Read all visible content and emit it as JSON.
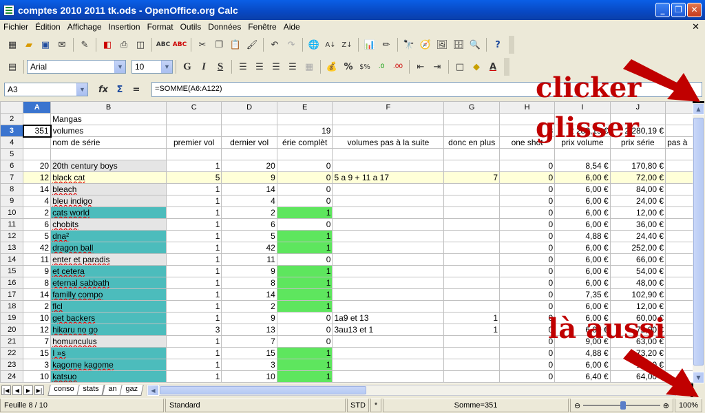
{
  "window": {
    "title": "comptes 2010 2011 tk.ods - OpenOffice.org Calc"
  },
  "menu": {
    "items": [
      "Fichier",
      "Édition",
      "Affichage",
      "Insertion",
      "Format",
      "Outils",
      "Données",
      "Fenêtre",
      "Aide"
    ]
  },
  "font": {
    "name": "Arial",
    "size": "10"
  },
  "namebox": {
    "value": "A3"
  },
  "formula": {
    "value": "=SOMME(A6:A122)"
  },
  "columns": [
    "A",
    "B",
    "C",
    "D",
    "E",
    "F",
    "G",
    "H",
    "I",
    "J"
  ],
  "rows": [
    {
      "n": "2",
      "a": "",
      "b": "Mangas",
      "c": "",
      "d": "",
      "e": "",
      "f": "",
      "g": "",
      "h": "",
      "i": "",
      "j": ""
    },
    {
      "n": "3",
      "a": "351",
      "b": "volumes",
      "c": "",
      "d": "",
      "e": "19",
      "f": "",
      "g": "",
      "h": "3",
      "i": "2 280,19 €",
      "j": "2 280,19 €"
    },
    {
      "n": "4",
      "a": "",
      "b": "nom de série",
      "c": "premier vol",
      "d": "dernier vol",
      "e": "érie complèt",
      "f": "volumes pas à la suite",
      "g": "donc en plus",
      "h": "one shot",
      "i": "prix volume",
      "j": "prix série"
    },
    {
      "n": "5",
      "a": "",
      "b": "",
      "c": "",
      "d": "",
      "e": "",
      "f": "",
      "g": "",
      "h": "",
      "i": "",
      "j": ""
    },
    {
      "n": "6",
      "a": "20",
      "b": "20th century boys",
      "c": "1",
      "d": "20",
      "e": "0",
      "f": "",
      "g": "",
      "h": "0",
      "i": "8,54 €",
      "j": "170,80 €"
    },
    {
      "n": "7",
      "a": "12",
      "b": "black cat",
      "c": "5",
      "d": "9",
      "e": "0",
      "f": "5 a 9  + 11 a 17",
      "g": "7",
      "h": "0",
      "i": "6,00 €",
      "j": "72,00 €"
    },
    {
      "n": "8",
      "a": "14",
      "b": "bleach",
      "c": "1",
      "d": "14",
      "e": "0",
      "f": "",
      "g": "",
      "h": "0",
      "i": "6,00 €",
      "j": "84,00 €"
    },
    {
      "n": "9",
      "a": "4",
      "b": "bleu indigo",
      "c": "1",
      "d": "4",
      "e": "0",
      "f": "",
      "g": "",
      "h": "0",
      "i": "6,00 €",
      "j": "24,00 €"
    },
    {
      "n": "10",
      "a": "2",
      "b": "cats world",
      "c": "1",
      "d": "2",
      "e": "1",
      "f": "",
      "g": "",
      "h": "0",
      "i": "6,00 €",
      "j": "12,00 €"
    },
    {
      "n": "11",
      "a": "6",
      "b": "chobits",
      "c": "1",
      "d": "6",
      "e": "0",
      "f": "",
      "g": "",
      "h": "0",
      "i": "6,00 €",
      "j": "36,00 €"
    },
    {
      "n": "12",
      "a": "5",
      "b": "dna²",
      "c": "1",
      "d": "5",
      "e": "1",
      "f": "",
      "g": "",
      "h": "0",
      "i": "4,88 €",
      "j": "24,40 €"
    },
    {
      "n": "13",
      "a": "42",
      "b": "dragon ball",
      "c": "1",
      "d": "42",
      "e": "1",
      "f": "",
      "g": "",
      "h": "0",
      "i": "6,00 €",
      "j": "252,00 €"
    },
    {
      "n": "14",
      "a": "11",
      "b": "enter et paradis",
      "c": "1",
      "d": "11",
      "e": "0",
      "f": "",
      "g": "",
      "h": "0",
      "i": "6,00 €",
      "j": "66,00 €"
    },
    {
      "n": "15",
      "a": "9",
      "b": "et cetera",
      "c": "1",
      "d": "9",
      "e": "1",
      "f": "",
      "g": "",
      "h": "0",
      "i": "6,00 €",
      "j": "54,00 €"
    },
    {
      "n": "16",
      "a": "8",
      "b": "eternal sabbath",
      "c": "1",
      "d": "8",
      "e": "1",
      "f": "",
      "g": "",
      "h": "0",
      "i": "6,00 €",
      "j": "48,00 €"
    },
    {
      "n": "17",
      "a": "14",
      "b": "familly compo",
      "c": "1",
      "d": "14",
      "e": "1",
      "f": "",
      "g": "",
      "h": "0",
      "i": "7,35 €",
      "j": "102,90 €"
    },
    {
      "n": "18",
      "a": "2",
      "b": "flcl",
      "c": "1",
      "d": "2",
      "e": "1",
      "f": "",
      "g": "",
      "h": "0",
      "i": "6,00 €",
      "j": "12,00 €"
    },
    {
      "n": "19",
      "a": "10",
      "b": "get backers",
      "c": "1",
      "d": "9",
      "e": "0",
      "f": "1a9 et 13",
      "g": "1",
      "h": "0",
      "i": "6,00 €",
      "j": "60,00 €"
    },
    {
      "n": "20",
      "a": "12",
      "b": "hikaru no go",
      "c": "3",
      "d": "13",
      "e": "0",
      "f": "3au13 et 1",
      "g": "1",
      "h": "0",
      "i": "6,00 €",
      "j": "72,00 €"
    },
    {
      "n": "21",
      "a": "7",
      "b": "homunculus",
      "c": "1",
      "d": "7",
      "e": "0",
      "f": "",
      "g": "",
      "h": "0",
      "i": "9,00 €",
      "j": "63,00 €"
    },
    {
      "n": "22",
      "a": "15",
      "b": "I »s",
      "c": "1",
      "d": "15",
      "e": "1",
      "f": "",
      "g": "",
      "h": "0",
      "i": "4,88 €",
      "j": "73,20 €"
    },
    {
      "n": "23",
      "a": "3",
      "b": "kagome kagome",
      "c": "1",
      "d": "3",
      "e": "1",
      "f": "",
      "g": "",
      "h": "0",
      "i": "6,00 €",
      "j": "18,00 €"
    },
    {
      "n": "24",
      "a": "10",
      "b": "katsuo",
      "c": "1",
      "d": "10",
      "e": "1",
      "f": "",
      "g": "",
      "h": "0",
      "i": "6,40 €",
      "j": "64,00 €"
    }
  ],
  "col_k_header": "pas à",
  "sheet_tabs": [
    "conso",
    "stats",
    "an",
    "gaz"
  ],
  "status": {
    "sheet": "Feuille 8 / 10",
    "style": "Standard",
    "mode": "STD",
    "modified": "*",
    "sum": "Somme=351",
    "zoom": "100%"
  },
  "annotations": {
    "click": "clicker",
    "drag": "glisser",
    "also": "là aussi"
  },
  "colors": {
    "teal": "#4cbcbc",
    "green": "#5ee65e",
    "grey": "#e5e5e5",
    "yellow": "#ffffd8",
    "annotation": "#c00000",
    "selection": "#3a74cf"
  }
}
